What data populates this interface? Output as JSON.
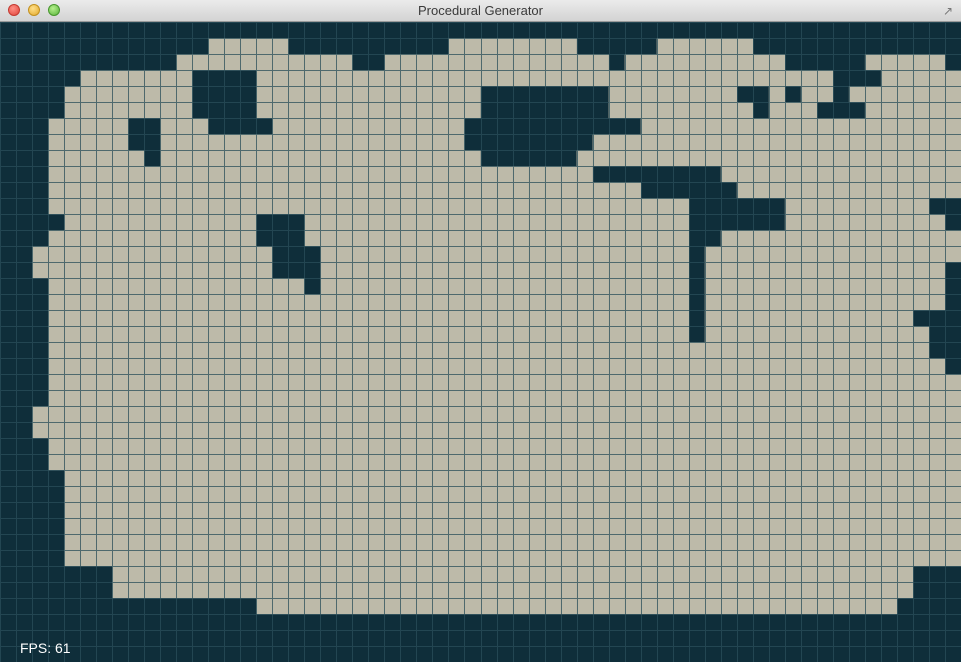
{
  "window": {
    "title": "Procedural Generator",
    "close_icon": "close-icon",
    "minimize_icon": "minimize-icon",
    "zoom_icon": "zoom-icon",
    "fullscreen_icon": "fullscreen-icon"
  },
  "map": {
    "columns": 60,
    "rows": 40,
    "colors": {
      "wall": "#0f2e3a",
      "floor": "#bdbaa9",
      "grid_line_on_wall": "#2a4f5a",
      "grid_line_on_floor": "#8f8d80"
    },
    "cells": [
      "000000000000000000000000000000000000000000000000000000000000",
      "000000000000011111000000000011111111000001111110000000000000",
      "000000000001111111111100111111111111110111111111100000111110",
      "000001111111000011111111111111111111111111111111111100011111",
      "000011111111000011111111111111000000001111111100101101111111",
      "000011111111000011111111111111000000001111111110111000111111",
      "000111110011100001111111111110000000000011111111111111111111",
      "000111110011111111111111111110000000011111111111111111111111",
      "000111111011111111111111111111000000111111111111111111111111",
      "000111111111111111111111111111111111100000000111111111111111",
      "000111111111111111111111111111111111111100000011111111111111",
      "000111111111111111111111111111111111111111100000011111111100",
      "000011111111111100011111111111111111111111100000011111111110",
      "000111111111111100011111111111111111111111100111111111111111",
      "001111111111111110001111111111111111111111101111111111111111",
      "001111111111111110001111111111111111111111101111111111111110",
      "000111111111111111101111111111111111111111101111111111111110",
      "000111111111111111111111111111111111111111101111111111111110",
      "000111111111111111111111111111111111111111101111111111111000",
      "000111111111111111111111111111111111111111101111111111111100",
      "000111111111111111111111111111111111111111111111111111111100",
      "000111111111111111111111111111111111111111111111111111111110",
      "000111111111111111111111111111111111111111111111111111111111",
      "000111111111111111111111111111111111111111111111111111111111",
      "001111111111111111111111111111111111111111111111111111111111",
      "001111111111111111111111111111111111111111111111111111111111",
      "000111111111111111111111111111111111111111111111111111111111",
      "000111111111111111111111111111111111111111111111111111111111",
      "000011111111111111111111111111111111111111111111111111111111",
      "000011111111111111111111111111111111111111111111111111111111",
      "000011111111111111111111111111111111111111111111111111111111",
      "000011111111111111111111111111111111111111111111111111111111",
      "000011111111111111111111111111111111111111111111111111111111",
      "000011111111111111111111111111111111111111111111111111111111",
      "000000011111111111111111111111111111111111111111111111111000",
      "000000011111111111111111111111111111111111111111111111111000",
      "000000000000000011111111111111111111111111111111111111110000",
      "000000000000000000000000000000000000000000000000000000000000",
      "000000000000000000000000000000000000000000000000000000000000",
      "000000000000000000000000000000000000000000000000000000000000"
    ]
  },
  "status": {
    "fps_label": "FPS: 61"
  }
}
